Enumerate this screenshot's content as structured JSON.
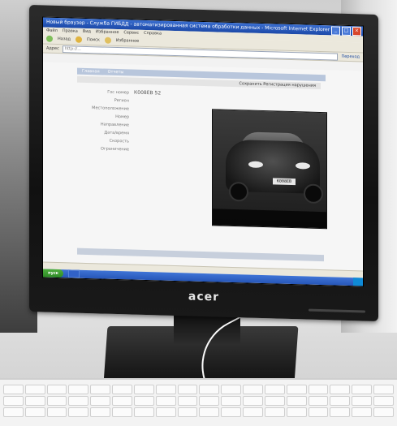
{
  "monitor": {
    "brand": "acer"
  },
  "browser": {
    "title": "Новый браузер - Служба ГИБДД - автоматизированная система обработки данных - Microsoft Internet Explorer",
    "menu": [
      "Файл",
      "Правка",
      "Вид",
      "Избранное",
      "Сервис",
      "Справка"
    ],
    "toolbar": [
      "Назад",
      "Поиск",
      "Избранное"
    ],
    "address_label": "Адрес",
    "address_value": "http://...",
    "go_label": "Переход"
  },
  "page": {
    "tabs": [
      "Главная",
      "Отчеты"
    ],
    "subbar_right": "Сохранить  Регистрация нарушения",
    "form_labels": [
      "Гос номер",
      "Регион",
      "Местоположение",
      "Номер",
      "Направление",
      "Дата/время",
      "Скорость",
      "Ограничение"
    ],
    "plate_value": "К008ЕВ 52",
    "form_values": [
      "",
      "",
      "",
      "",
      "",
      "",
      "",
      ""
    ],
    "photo": {
      "plate_text": "К008ЕВ",
      "caption": ""
    },
    "footer_left": "",
    "footer_center": "",
    "footer_right": "",
    "footer_bar": ""
  },
  "status_bar": {
    "left": "",
    "right": ""
  },
  "taskbar": {
    "start": "пуск",
    "task": "",
    "clock": ""
  }
}
